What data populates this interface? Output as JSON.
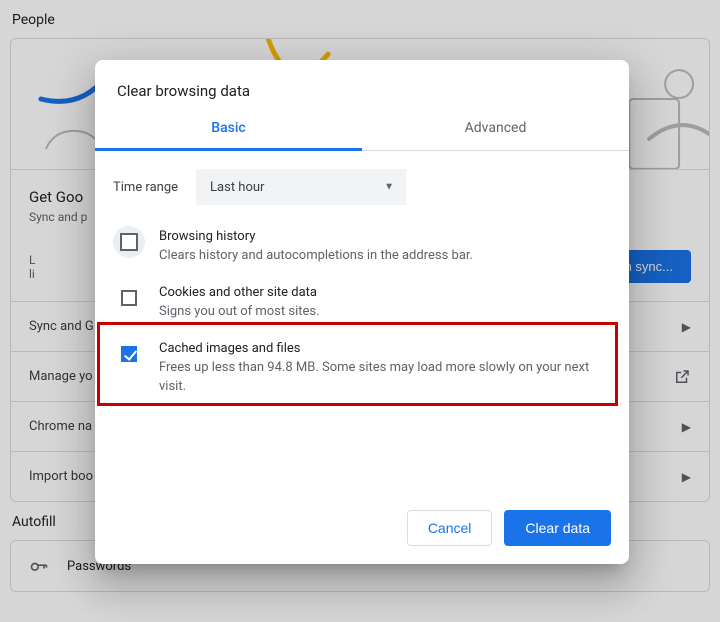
{
  "bg": {
    "section_people": "People",
    "get_google_title": "Get Goo",
    "get_google_sub": "Sync and p",
    "turn_on_left_line1": "L",
    "turn_on_left_line2": "li",
    "turn_on_btn": "n sync...",
    "rows": {
      "sync": "Sync and G",
      "manage": "Manage yo",
      "chrome_name": "Chrome na",
      "import": "Import boo"
    },
    "section_autofill": "Autofill",
    "passwords": "Passwords"
  },
  "dialog": {
    "title": "Clear browsing data",
    "tabs": {
      "basic": "Basic",
      "advanced": "Advanced"
    },
    "time_label": "Time range",
    "time_value": "Last hour",
    "options": [
      {
        "title": "Browsing history",
        "desc": "Clears history and autocompletions in the address bar.",
        "checked": false
      },
      {
        "title": "Cookies and other site data",
        "desc": "Signs you out of most sites.",
        "checked": false
      },
      {
        "title": "Cached images and files",
        "desc": "Frees up less than 94.8 MB. Some sites may load more slowly on your next visit.",
        "checked": true
      }
    ],
    "cancel": "Cancel",
    "clear": "Clear data"
  }
}
